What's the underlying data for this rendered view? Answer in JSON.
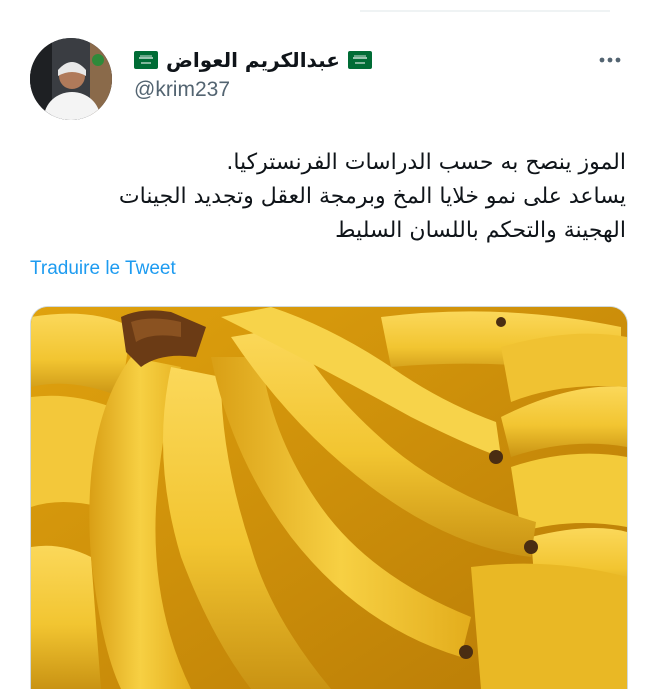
{
  "tweet": {
    "author_name": "عبدالكريم العواض",
    "handle": "@krim237",
    "text_lines": [
      "الموز ينصح به حسب الدراسات الفرنستركيا.",
      "يساعد على نمو خلايا المخ وبرمجة العقل وتجديد الجينات",
      "الهجينة والتحكم باللسان السليط"
    ],
    "translate_label": "Traduire le Tweet",
    "more_icon": "more-horizontal-icon",
    "flag_icon": "saudi-flag-icon",
    "media_description_icon": "bananas-photo"
  },
  "colors": {
    "link": "#1d9bf0",
    "secondary_text": "#536471",
    "primary_text": "#0f1419",
    "flag_green": "#006c35"
  }
}
